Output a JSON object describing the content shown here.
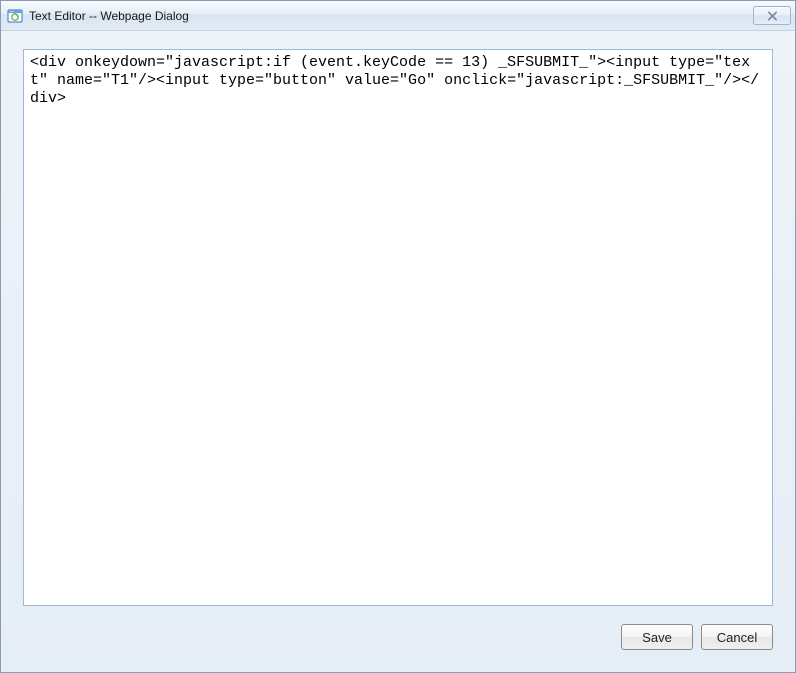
{
  "window": {
    "title": "Text Editor -- Webpage Dialog"
  },
  "editor": {
    "content": "<div onkeydown=\"javascript:if (event.keyCode == 13) _SFSUBMIT_\"><input type=\"text\" name=\"T1\"/><input type=\"button\" value=\"Go\" onclick=\"javascript:_SFSUBMIT_\"/></div>"
  },
  "buttons": {
    "save": "Save",
    "cancel": "Cancel"
  }
}
